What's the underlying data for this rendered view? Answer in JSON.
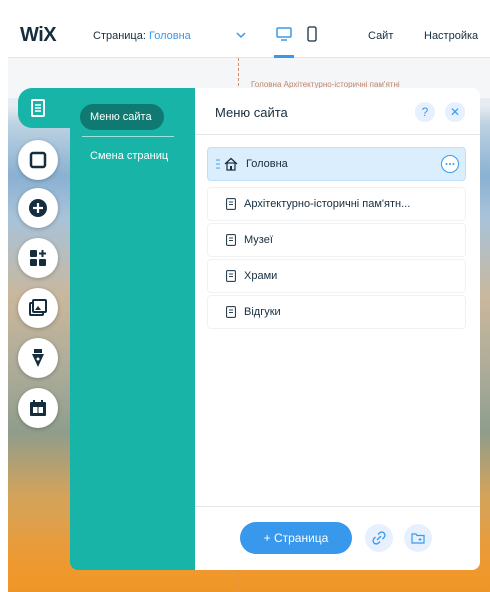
{
  "topbar": {
    "logo": "WiX",
    "page_prefix": "Страница: ",
    "page_value": "Головна",
    "site": "Сайт",
    "settings": "Настройка"
  },
  "canvas": {
    "breadcrumb": "Головна     Архітектурно-історичні пам'ятні"
  },
  "rail": {
    "items": [
      "pages-icon",
      "background-icon",
      "add-icon",
      "apps-icon",
      "media-icon",
      "blog-icon",
      "bookings-icon"
    ]
  },
  "side_menu": {
    "tab_active": "Меню сайта",
    "tab_other": "Смена страниц"
  },
  "panel": {
    "title": "Меню сайта",
    "help": "?",
    "close": "✕",
    "pages": [
      {
        "label": "Головна",
        "home": true
      },
      {
        "label": "Архітектурно-історичні пам'ятн..."
      },
      {
        "label": "Музеї"
      },
      {
        "label": "Храми"
      },
      {
        "label": "Відгуки"
      }
    ],
    "add_page": "+ Страница"
  },
  "colors": {
    "teal": "#18b4a8",
    "accent": "#3899ec",
    "selected_row": "#daeefd"
  }
}
